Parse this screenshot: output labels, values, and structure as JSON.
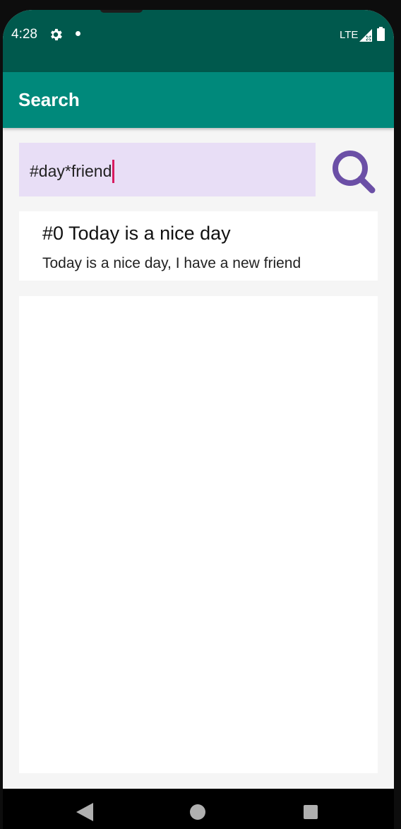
{
  "status_bar": {
    "time": "4:28",
    "network": "LTE",
    "icons": [
      "gear-icon",
      "notification-dot-icon",
      "signal-icon",
      "battery-icon"
    ]
  },
  "app_bar": {
    "title": "Search"
  },
  "search": {
    "query": "#day*friend",
    "button_icon": "search-icon"
  },
  "results": [
    {
      "title": "#0 Today is a nice day",
      "body": "Today is a nice day, I have a new friend"
    }
  ],
  "nav_bar": {
    "icons": [
      "back-icon",
      "home-icon",
      "recents-icon"
    ]
  },
  "colors": {
    "status_bar": "#00594d",
    "app_bar": "#00897b",
    "search_field": "#e8def6",
    "search_icon": "#6b4fa6",
    "cursor": "#d81b60"
  }
}
